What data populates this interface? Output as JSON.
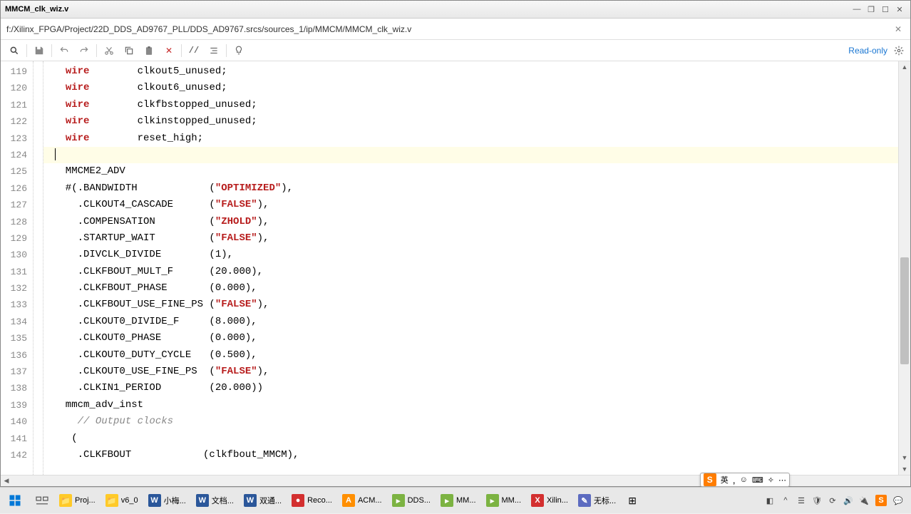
{
  "title": "MMCM_clk_wiz.v",
  "path": "f:/Xilinx_FPGA/Project/22D_DDS_AD9767_PLL/DDS_AD9767.srcs/sources_1/ip/MMCM/MMCM_clk_wiz.v",
  "readonly": "Read-only",
  "lines": [
    {
      "n": 119,
      "tokens": [
        {
          "t": "  ",
          "c": ""
        },
        {
          "t": "wire",
          "c": "kw"
        },
        {
          "t": "        clkout5_unused;",
          "c": ""
        }
      ]
    },
    {
      "n": 120,
      "tokens": [
        {
          "t": "  ",
          "c": ""
        },
        {
          "t": "wire",
          "c": "kw"
        },
        {
          "t": "        clkout6_unused;",
          "c": ""
        }
      ]
    },
    {
      "n": 121,
      "tokens": [
        {
          "t": "  ",
          "c": ""
        },
        {
          "t": "wire",
          "c": "kw"
        },
        {
          "t": "        clkfbstopped_unused;",
          "c": ""
        }
      ]
    },
    {
      "n": 122,
      "tokens": [
        {
          "t": "  ",
          "c": ""
        },
        {
          "t": "wire",
          "c": "kw"
        },
        {
          "t": "        clkinstopped_unused;",
          "c": ""
        }
      ]
    },
    {
      "n": 123,
      "tokens": [
        {
          "t": "  ",
          "c": ""
        },
        {
          "t": "wire",
          "c": "kw"
        },
        {
          "t": "        reset_high;",
          "c": ""
        }
      ]
    },
    {
      "n": 124,
      "tokens": [],
      "current": true
    },
    {
      "n": 125,
      "tokens": [
        {
          "t": "  MMCME2_ADV",
          "c": ""
        }
      ]
    },
    {
      "n": 126,
      "tokens": [
        {
          "t": "  #(.BANDWIDTH            (",
          "c": ""
        },
        {
          "t": "\"OPTIMIZED\"",
          "c": "str"
        },
        {
          "t": "),",
          "c": ""
        }
      ]
    },
    {
      "n": 127,
      "tokens": [
        {
          "t": "    .CLKOUT4_CASCADE      (",
          "c": ""
        },
        {
          "t": "\"FALSE\"",
          "c": "str"
        },
        {
          "t": "),",
          "c": ""
        }
      ]
    },
    {
      "n": 128,
      "tokens": [
        {
          "t": "    .COMPENSATION         (",
          "c": ""
        },
        {
          "t": "\"ZHOLD\"",
          "c": "str"
        },
        {
          "t": "),",
          "c": ""
        }
      ]
    },
    {
      "n": 129,
      "tokens": [
        {
          "t": "    .STARTUP_WAIT         (",
          "c": ""
        },
        {
          "t": "\"FALSE\"",
          "c": "str"
        },
        {
          "t": "),",
          "c": ""
        }
      ]
    },
    {
      "n": 130,
      "tokens": [
        {
          "t": "    .DIVCLK_DIVIDE        (1),",
          "c": ""
        }
      ]
    },
    {
      "n": 131,
      "tokens": [
        {
          "t": "    .CLKFBOUT_MULT_F      (20.000),",
          "c": ""
        }
      ]
    },
    {
      "n": 132,
      "tokens": [
        {
          "t": "    .CLKFBOUT_PHASE       (0.000),",
          "c": ""
        }
      ]
    },
    {
      "n": 133,
      "tokens": [
        {
          "t": "    .CLKFBOUT_USE_FINE_PS (",
          "c": ""
        },
        {
          "t": "\"FALSE\"",
          "c": "str"
        },
        {
          "t": "),",
          "c": ""
        }
      ]
    },
    {
      "n": 134,
      "tokens": [
        {
          "t": "    .CLKOUT0_DIVIDE_F     (8.000),",
          "c": ""
        }
      ]
    },
    {
      "n": 135,
      "tokens": [
        {
          "t": "    .CLKOUT0_PHASE        (0.000),",
          "c": ""
        }
      ]
    },
    {
      "n": 136,
      "tokens": [
        {
          "t": "    .CLKOUT0_DUTY_CYCLE   (0.500),",
          "c": ""
        }
      ]
    },
    {
      "n": 137,
      "tokens": [
        {
          "t": "    .CLKOUT0_USE_FINE_PS  (",
          "c": ""
        },
        {
          "t": "\"FALSE\"",
          "c": "str"
        },
        {
          "t": "),",
          "c": ""
        }
      ]
    },
    {
      "n": 138,
      "tokens": [
        {
          "t": "    .CLKIN1_PERIOD        (20.000))",
          "c": ""
        }
      ]
    },
    {
      "n": 139,
      "tokens": [
        {
          "t": "  mmcm_adv_inst",
          "c": ""
        }
      ]
    },
    {
      "n": 140,
      "tokens": [
        {
          "t": "    ",
          "c": ""
        },
        {
          "t": "// Output clocks",
          "c": "cmt"
        }
      ]
    },
    {
      "n": 141,
      "tokens": [
        {
          "t": "   (",
          "c": ""
        }
      ]
    },
    {
      "n": 142,
      "tokens": [
        {
          "t": "    .CLKFBOUT            (clkfbout_MMCM),",
          "c": ""
        }
      ]
    }
  ],
  "taskbar": [
    {
      "icon": "📁",
      "label": "Proj...",
      "color": "#ffca28"
    },
    {
      "icon": "📁",
      "label": "v6_0",
      "color": "#ffca28"
    },
    {
      "icon": "W",
      "label": "小梅...",
      "color": "#2b579a"
    },
    {
      "icon": "W",
      "label": "文档...",
      "color": "#2b579a"
    },
    {
      "icon": "W",
      "label": "双通...",
      "color": "#2b579a"
    },
    {
      "icon": "●",
      "label": "Reco...",
      "color": "#d32f2f"
    },
    {
      "icon": "A",
      "label": "ACM...",
      "color": "#ff8f00"
    },
    {
      "icon": "▸",
      "label": "DDS...",
      "color": "#7cb342"
    },
    {
      "icon": "▸",
      "label": "MM...",
      "color": "#7cb342"
    },
    {
      "icon": "▸",
      "label": "MM...",
      "color": "#7cb342"
    },
    {
      "icon": "X",
      "label": "Xilin...",
      "color": "#d32f2f"
    },
    {
      "icon": "✎",
      "label": "无标...",
      "color": "#5c6bc0"
    }
  ],
  "ime": {
    "s": "S",
    "lang": "英",
    "punct": ",",
    "emoji": "☺",
    "kbd": "⌨",
    "q": "✧",
    "more": "⋯"
  },
  "tray_icons": [
    "◧",
    "^",
    "☰",
    "🛡",
    "⟳",
    "🔊",
    "🔌"
  ]
}
